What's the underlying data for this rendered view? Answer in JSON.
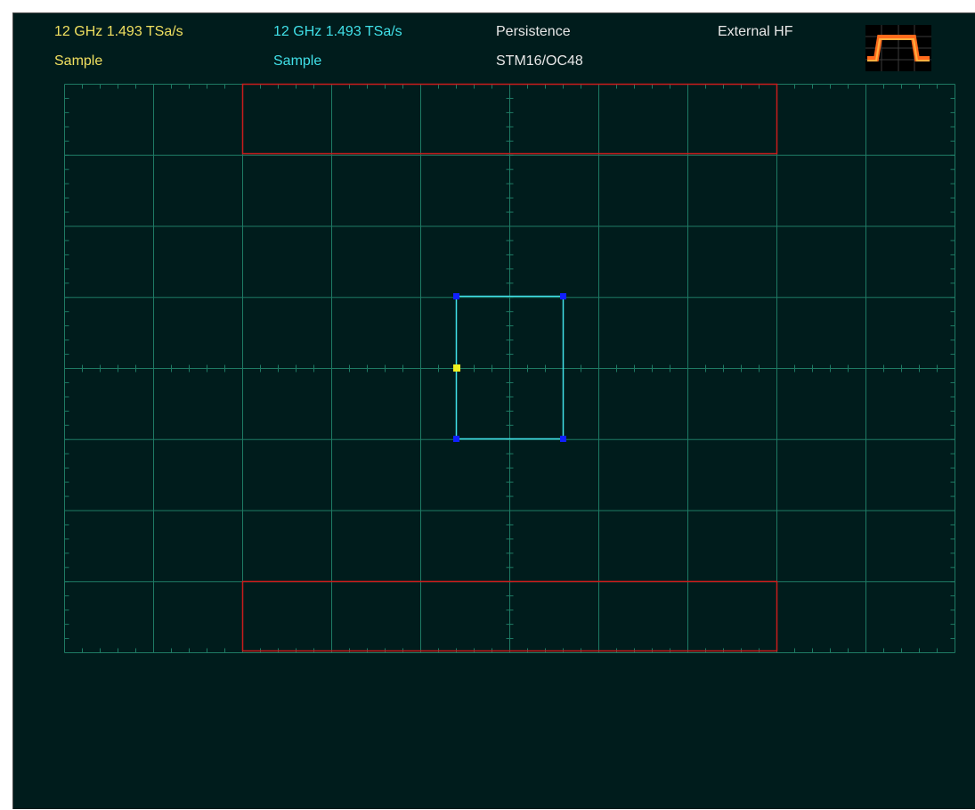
{
  "status_bar": {
    "ch1_rate": "12 GHz  1.493 TSa/s",
    "ch1_mode": "Sample",
    "ch2_rate": "12 GHz  1.493 TSa/s",
    "ch2_mode": "Sample",
    "display_mode": "Persistence",
    "mask_standard": "STM16/OC48",
    "trigger_source": "External HF"
  },
  "icons": {
    "trigger_icon": "pulse-waveform-icon"
  },
  "colors": {
    "background": "#001c1c",
    "grid": "#1e7a64",
    "ch1_text": "#f0e060",
    "ch2_text": "#40e0e8",
    "mask_region": "#c81c1c",
    "cursor_box": "#40e0e8",
    "cursor_handle": "#1020ff",
    "reference_marker": "#f0f020",
    "trigger_icon": "#ff6a1c"
  }
}
